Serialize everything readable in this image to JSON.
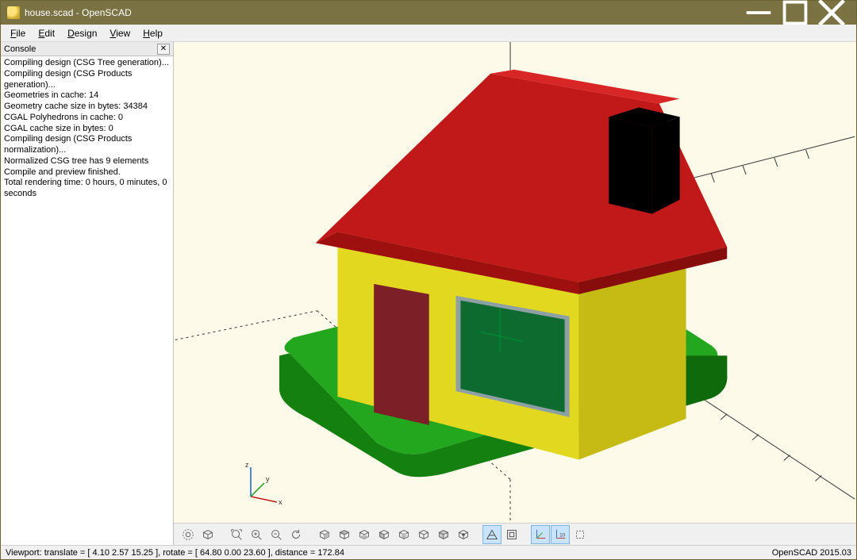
{
  "window": {
    "title": "house.scad - OpenSCAD"
  },
  "menu": {
    "file": "File",
    "edit": "Edit",
    "design": "Design",
    "view": "View",
    "help": "Help"
  },
  "console": {
    "title": "Console",
    "body": "Compiling design (CSG Tree generation)...\nCompiling design (CSG Products generation)...\nGeometries in cache: 14\nGeometry cache size in bytes: 34384\nCGAL Polyhedrons in cache: 0\nCGAL cache size in bytes: 0\nCompiling design (CSG Products normalization)...\nNormalized CSG tree has 9 elements\nCompile and preview finished.\nTotal rendering time: 0 hours, 0 minutes, 0 seconds"
  },
  "axis": {
    "x": "x",
    "y": "y",
    "z": "z"
  },
  "statusbar": {
    "viewport": "Viewport: translate = [ 4.10 2.57 15.25 ], rotate = [ 64.80 0.00 23.60 ], distance = 172.84",
    "version": "OpenSCAD 2015.03"
  },
  "toolbar": {
    "preview": "preview",
    "render": "render",
    "view_all": "view-all",
    "zoom_in": "zoom-in",
    "zoom_out": "zoom-out",
    "reset": "reset-view",
    "right": "right-view",
    "top": "top-view",
    "bottom": "bottom-view",
    "left": "left-view",
    "front": "front-view",
    "back": "back-view",
    "diagonal": "diagonal-view",
    "center": "center-view",
    "perspective": "perspective",
    "orthographic": "orthographic",
    "axes": "show-axes",
    "scale": "show-scale",
    "crosshairs": "show-crosshairs"
  }
}
